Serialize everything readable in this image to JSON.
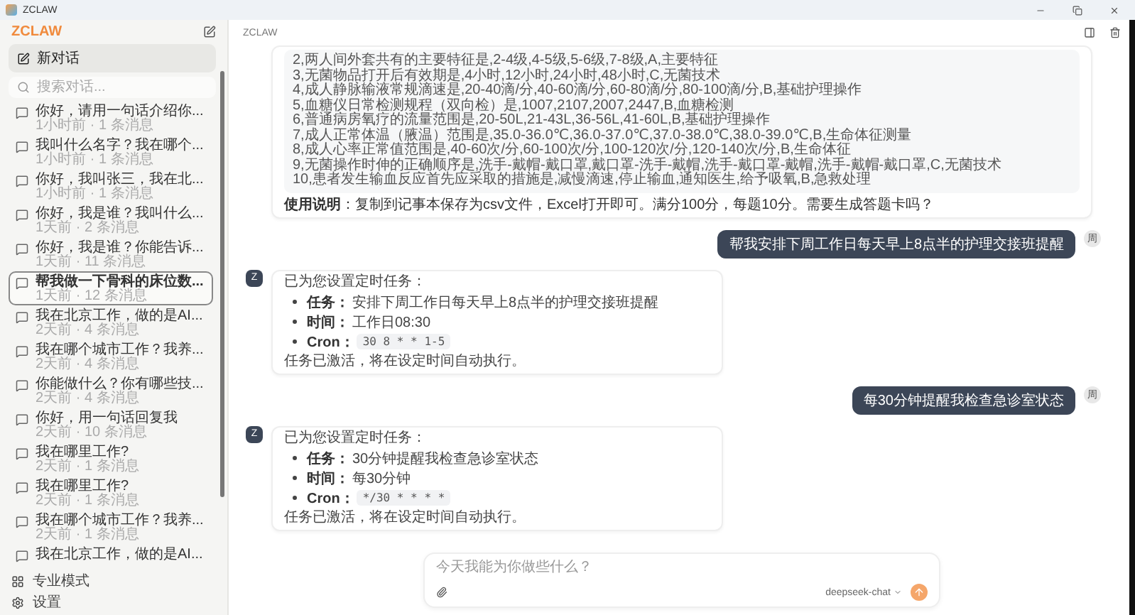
{
  "window": {
    "title": "ZCLAW"
  },
  "sidebar": {
    "logo": "ZCLAW",
    "new_chat": "新对话",
    "search": {
      "placeholder": "搜索对话..."
    },
    "conversations": [
      {
        "title": "你好，请用一句话介绍你...",
        "meta": "1小时前 · 1 条消息",
        "selected": false
      },
      {
        "title": "我叫什么名字？我在哪个...",
        "meta": "1小时前 · 1 条消息",
        "selected": false
      },
      {
        "title": "你好，我叫张三，我在北...",
        "meta": "1小时前 · 1 条消息",
        "selected": false
      },
      {
        "title": "你好，我是谁？我叫什么...",
        "meta": "1天前 · 2 条消息",
        "selected": false
      },
      {
        "title": "你好，我是谁？你能告诉...",
        "meta": "1天前 · 11 条消息",
        "selected": false
      },
      {
        "title": "帮我做一下骨科的床位数...",
        "meta": "1天前 · 12 条消息",
        "selected": true
      },
      {
        "title": "我在北京工作，做的是AI...",
        "meta": "2天前 · 4 条消息",
        "selected": false
      },
      {
        "title": "我在哪个城市工作？我养...",
        "meta": "2天前 · 4 条消息",
        "selected": false
      },
      {
        "title": "你能做什么？你有哪些技...",
        "meta": "2天前 · 4 条消息",
        "selected": false
      },
      {
        "title": "你好，用一句话回复我",
        "meta": "2天前 · 10 条消息",
        "selected": false
      },
      {
        "title": "我在哪里工作?",
        "meta": "2天前 · 1 条消息",
        "selected": false
      },
      {
        "title": "我在哪里工作?",
        "meta": "2天前 · 1 条消息",
        "selected": false
      },
      {
        "title": "我在哪个城市工作？我养...",
        "meta": "2天前 · 1 条消息",
        "selected": false
      },
      {
        "title": "我在北京工作，做的是AI...",
        "selected": false
      }
    ],
    "footer": [
      {
        "kind": "mode",
        "label": "专业模式"
      },
      {
        "kind": "settings",
        "label": "设置"
      }
    ]
  },
  "header": {
    "title": "ZCLAW"
  },
  "messages": [
    {
      "kind": "code",
      "lines": [
        "2,两人间外套共有的主要特征是,2-4级,4-5级,5-6级,7-8级,A,主要特征",
        "3,无菌物品打开后有效期是,4小时,12小时,24小时,48小时,C,无菌技术",
        "4,成人静脉输液常规滴速是,20-40滴/分,40-60滴/分,60-80滴/分,80-100滴/分,B,基础护理操作",
        "5,血糖仪日常检测规程（双向检）是,1007,2107,2007,2447,B,血糖检测",
        "6,普通病房氧疗的流量范围是,20-50L,21-43L,36-56L,41-60L,B,基础护理操作",
        "7,成人正常体温（腋温）范围是,35.0-36.0℃,36.0-37.0℃,37.0-38.0℃,38.0-39.0℃,B,生命体征测量",
        "8,成人心率正常值范围是,40-60次/分,60-100次/分,100-120次/分,120-140次/分,B,生命体征",
        "9,无菌操作时伸的正确顺序是,洗手-戴帽-戴口罩,戴口罩-洗手-戴帽,洗手-戴口罩-戴帽,洗手-戴帽-戴口罩,C,无菌技术",
        "10,患者发生输血反应首先应采取的措施是,减慢滴速,停止输血,通知医生,给予吸氧,B,急救处理"
      ],
      "note": "**使用说明**：复制到记事本保存为csv文件，Excel打开即可。满分100分，每题10分。需要生成答题卡吗？"
    },
    {
      "kind": "user",
      "avatar": "周",
      "text": "帮我安排下周工作日每天早上8点半的护理交接班提醒"
    },
    {
      "kind": "task",
      "avatar": "Z",
      "intro": "已为您设置定时任务：",
      "items": [
        {
          "label": "任务：",
          "value": "安排下周工作日每天早上8点半的护理交接班提醒",
          "kind": "text"
        },
        {
          "label": "时间：",
          "value": "工作日08:30",
          "kind": "text"
        },
        {
          "label": "Cron：",
          "value": "30 8 * * 1-5",
          "kind": "code"
        }
      ],
      "outro": "任务已激活，将在设定时间自动执行。"
    },
    {
      "kind": "user",
      "avatar": "周",
      "text": "每30分钟提醒我检查急诊室状态"
    },
    {
      "kind": "task",
      "avatar": "Z",
      "intro": "已为您设置定时任务：",
      "items": [
        {
          "label": "任务：",
          "value": "30分钟提醒我检查急诊室状态",
          "kind": "text"
        },
        {
          "label": "时间：",
          "value": "每30分钟",
          "kind": "text"
        },
        {
          "label": "Cron：",
          "value": "*/30 * * * *",
          "kind": "code"
        }
      ],
      "outro": "任务已激活，将在设定时间自动执行。"
    }
  ],
  "composer": {
    "placeholder": "今天我能为你做些什么？",
    "model": "deepseek-chat"
  }
}
